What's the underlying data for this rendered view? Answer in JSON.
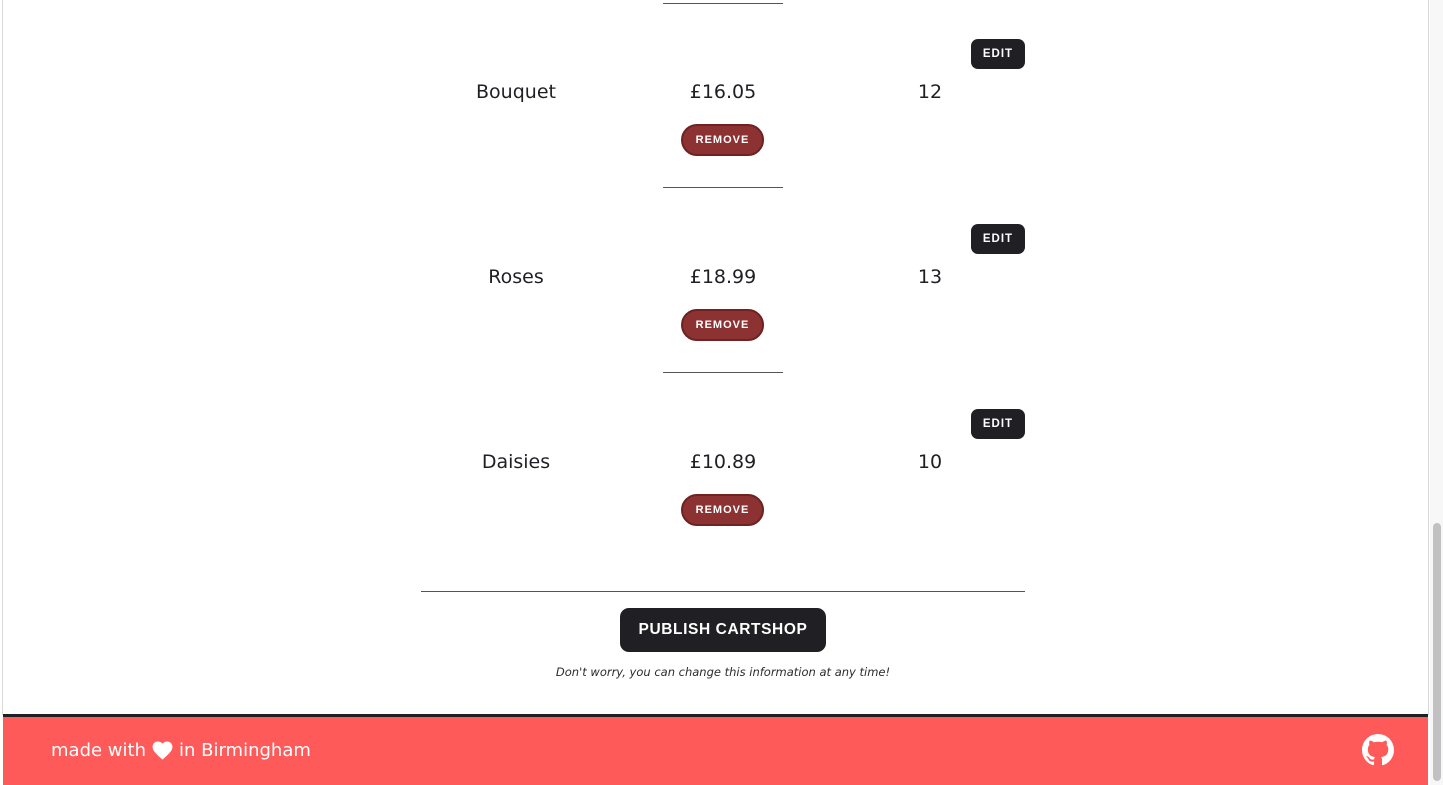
{
  "cart": {
    "items": [
      {
        "name": "Bouquet",
        "price": "£16.05",
        "quantity": "12",
        "edit_label": "EDIT",
        "remove_label": "REMOVE"
      },
      {
        "name": "Roses",
        "price": "£18.99",
        "quantity": "13",
        "edit_label": "EDIT",
        "remove_label": "REMOVE"
      },
      {
        "name": "Daisies",
        "price": "£10.89",
        "quantity": "10",
        "edit_label": "EDIT",
        "remove_label": "REMOVE"
      }
    ]
  },
  "actions": {
    "publish_label": "PUBLISH CARTSHOP",
    "note": "Don't worry, you can change this information at any time!"
  },
  "footer": {
    "text_before": "made with",
    "text_after": "in Birmingham",
    "heart_icon": "heart-icon",
    "github_icon": "github-icon"
  },
  "colors": {
    "dark": "#1f1f24",
    "remove": "#8c3232",
    "footer": "#ff5a5a"
  }
}
